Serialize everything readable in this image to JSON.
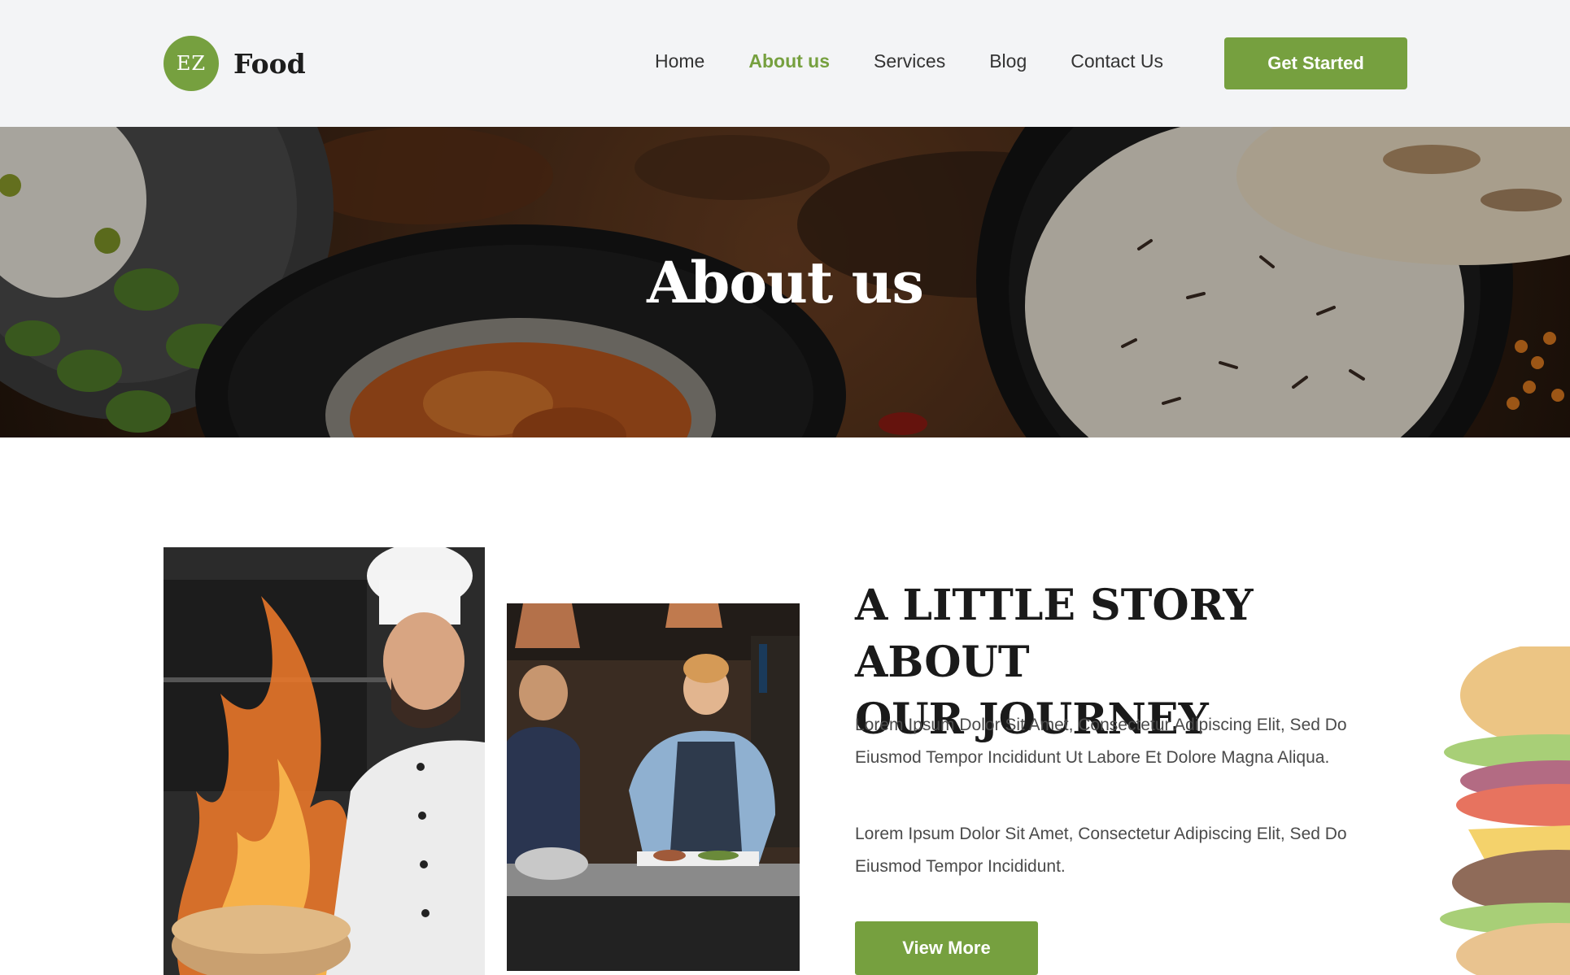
{
  "brand": {
    "badge": "EZ",
    "name": "Food"
  },
  "nav": {
    "items": [
      {
        "label": "Home",
        "active": false
      },
      {
        "label": "About us",
        "active": true
      },
      {
        "label": "Services",
        "active": false
      },
      {
        "label": "Blog",
        "active": false
      },
      {
        "label": "Contact Us",
        "active": false
      }
    ],
    "cta_label": "Get Started"
  },
  "hero": {
    "title": "About us"
  },
  "story": {
    "title_line1": "A LITTLE STORY ABOUT",
    "title_line2": "OUR JOURNEY",
    "paragraph1": "Lorem Ipsum Dolor Sit Amet, Consectetur Adipiscing Elit, Sed Do Eiusmod Tempor Incididunt Ut Labore Et Dolore Magna Aliqua.",
    "paragraph2": "Lorem Ipsum Dolor Sit Amet, Consectetur Adipiscing Elit, Sed Do Eiusmod Tempor Incididunt.",
    "button_label": "View More"
  },
  "colors": {
    "accent": "#76a03f",
    "header_bg": "#f3f4f6",
    "heading": "#1a1a1a",
    "body_text": "#4a4a4a"
  },
  "images": {
    "hero": "food-bowls-photo",
    "chef": "chef-flambe-photo",
    "kitchen": "cooks-in-kitchen-photo",
    "burger": "burger-photo"
  }
}
